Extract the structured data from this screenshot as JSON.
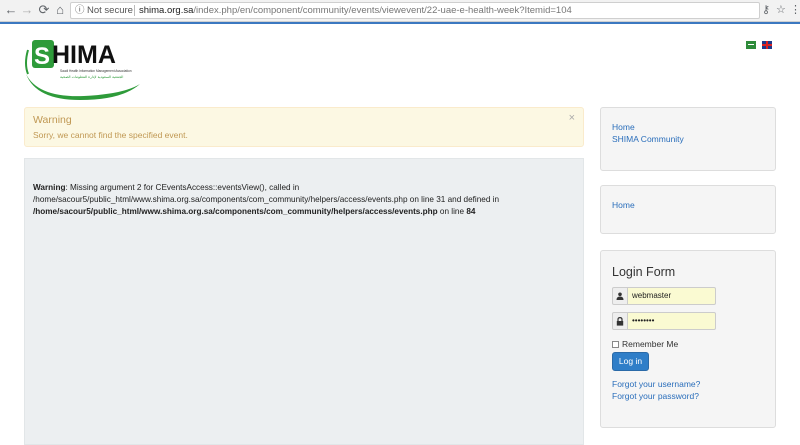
{
  "browser": {
    "back_icon": "back-arrow-icon",
    "forward_icon": "forward-arrow-icon",
    "reload_icon": "reload-icon",
    "home_icon": "home-icon",
    "security_label": "Not secure",
    "url_host": "shima.org.sa",
    "url_path": "/index.php/en/component/community/events/viewevent/22-uae-e-health-week?Itemid=104"
  },
  "header": {
    "logo_text": "SHIMA",
    "logo_subtitle": "Saudi Health Information Management Association",
    "logo_subtitle_ar": "الجمعية السعودية لإدارة المعلومات الصحية",
    "languages": [
      "Arabic",
      "English"
    ]
  },
  "alert": {
    "title": "Warning",
    "message": "Sorry, we cannot find the specified event.",
    "close_glyph": "×"
  },
  "php_warning": {
    "label": "Warning",
    "text_1": ": Missing argument 2 for CEventsAccess::eventsView(), called in",
    "text_2": "/home/sacour5/public_html/www.shima.org.sa/components/com_community/helpers/access/events.php on line 31 and defined in",
    "path": "/home/sacour5/public_html/www.shima.org.sa/components/com_community/helpers/access/events.php",
    "text_3": " on line ",
    "line": "84"
  },
  "breadcrumb_box": {
    "items": [
      "Home",
      "SHIMA Community"
    ]
  },
  "menu_box": {
    "items": [
      "Home"
    ]
  },
  "login": {
    "title": "Login Form",
    "username_value": "webmaster",
    "password_value": "••••••••",
    "remember_label": "Remember Me",
    "button_label": "Log in",
    "forgot_username": "Forgot your username?",
    "forgot_password": "Forgot your password?"
  },
  "colors": {
    "accent": "#3b78c0",
    "link": "#2a6ebb",
    "warning_bg": "#fcf8e3",
    "warning_text": "#c09853",
    "logo_green": "#2e9b3a",
    "button": "#2f7ec8"
  }
}
